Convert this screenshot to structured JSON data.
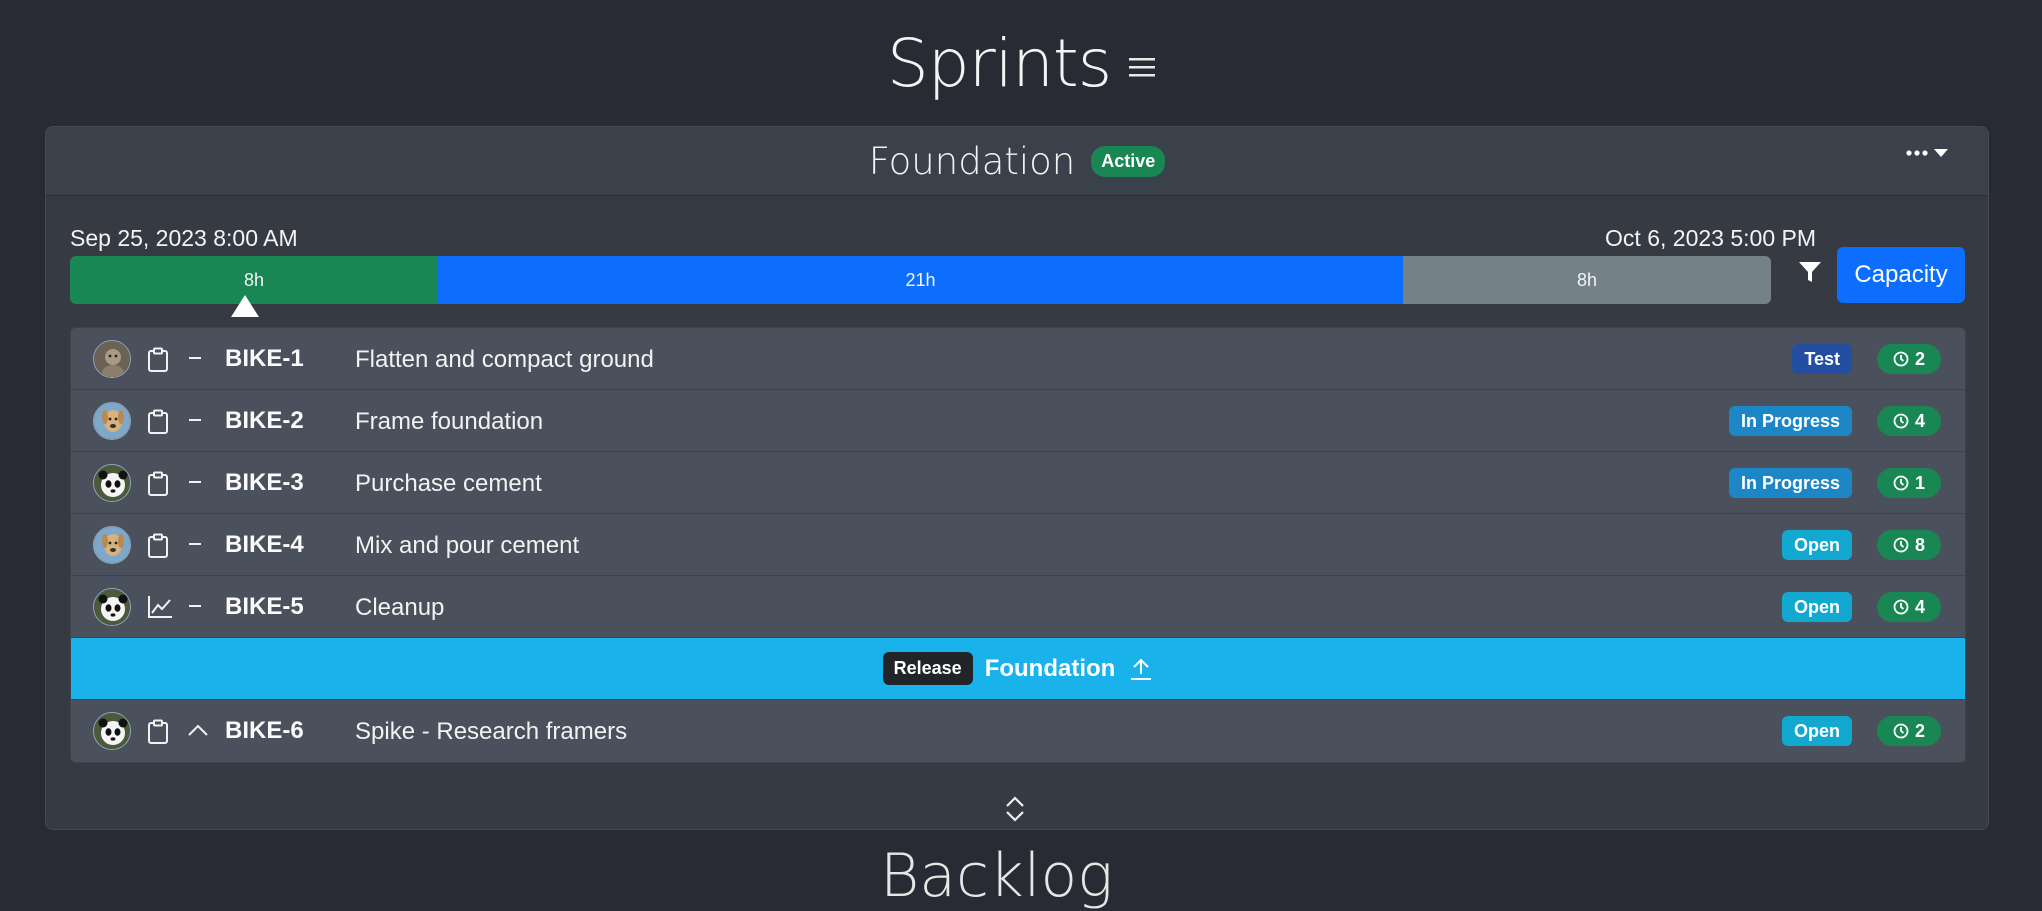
{
  "page": {
    "title": "Sprints",
    "next_section_title": "Backlog"
  },
  "sprint": {
    "name": "Foundation",
    "status": "Active",
    "start": "Sep 25, 2023 8:00 AM",
    "end": "Oct 6, 2023 5:00 PM",
    "timeline": {
      "done": "8h",
      "planned": "21h",
      "remaining": "8h"
    },
    "capacity_label": "Capacity"
  },
  "issues": [
    {
      "key": "BIKE-1",
      "title": "Flatten and compact ground",
      "status": "Test",
      "estimate": "2",
      "avatar": "animal-avatar",
      "type": "clipboard-icon",
      "priority": "minus-icon"
    },
    {
      "key": "BIKE-2",
      "title": "Frame foundation",
      "status": "In Progress",
      "estimate": "4",
      "avatar": "dog-avatar",
      "type": "clipboard-icon",
      "priority": "minus-icon"
    },
    {
      "key": "BIKE-3",
      "title": "Purchase cement",
      "status": "In Progress",
      "estimate": "1",
      "avatar": "panda-avatar",
      "type": "clipboard-icon",
      "priority": "minus-icon"
    },
    {
      "key": "BIKE-4",
      "title": "Mix and pour cement",
      "status": "Open",
      "estimate": "8",
      "avatar": "dog-avatar",
      "type": "clipboard-icon",
      "priority": "minus-icon"
    },
    {
      "key": "BIKE-5",
      "title": "Cleanup",
      "status": "Open",
      "estimate": "4",
      "avatar": "panda-avatar",
      "type": "chart-line-icon",
      "priority": "minus-icon"
    }
  ],
  "release": {
    "badge": "Release",
    "name": "Foundation"
  },
  "issues_after_release": [
    {
      "key": "BIKE-6",
      "title": "Spike - Research framers",
      "status": "Open",
      "estimate": "2",
      "avatar": "panda-avatar",
      "type": "clipboard-icon",
      "priority": "chevron-up-icon"
    }
  ],
  "colors": {
    "background": "#282b33",
    "card": "#353a43",
    "done": "#198754",
    "planned": "#0d6efd",
    "remaining": "#758189",
    "release": "#1ab2eb",
    "status_test": "#244ea0",
    "status_in_progress": "#1c86c6",
    "status_open": "#12a8cf"
  }
}
